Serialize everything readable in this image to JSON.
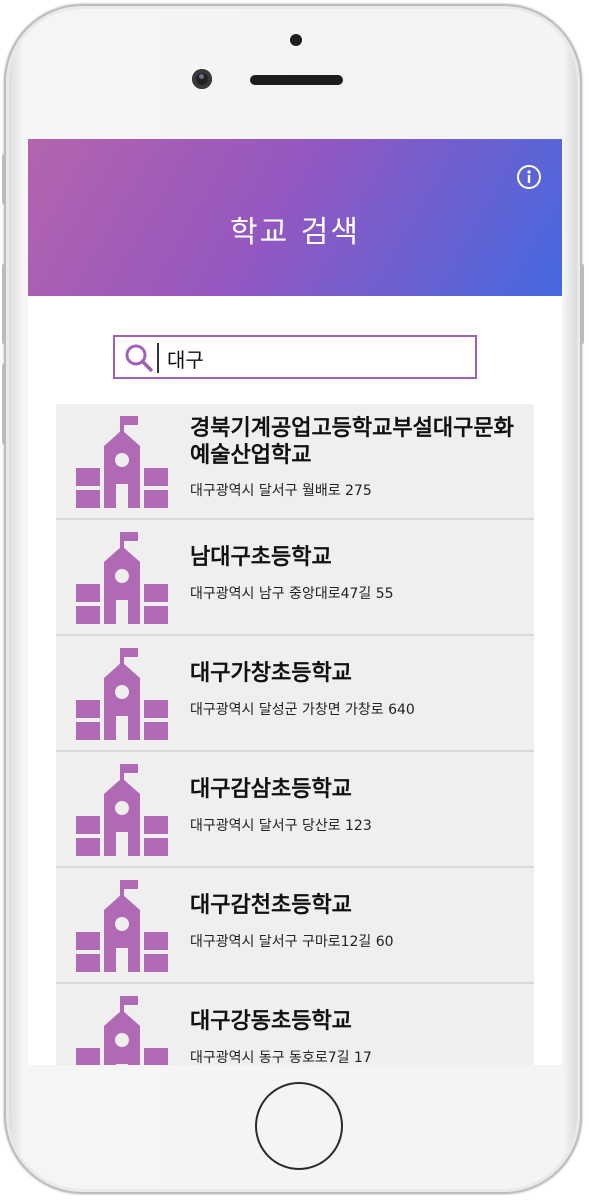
{
  "header": {
    "title": "학교 검색"
  },
  "search": {
    "value": "대구",
    "placeholder": ""
  },
  "results": [
    {
      "name": "경북기계공업고등학교부설대구문화예술산업학교",
      "address": "대구광역시 달서구 월배로 275"
    },
    {
      "name": "남대구초등학교",
      "address": "대구광역시 남구 중앙대로47길 55"
    },
    {
      "name": "대구가창초등학교",
      "address": "대구광역시 달성군 가창면 가창로 640"
    },
    {
      "name": "대구감삼초등학교",
      "address": "대구광역시 달서구 당산로 123"
    },
    {
      "name": "대구감천초등학교",
      "address": "대구광역시 달서구 구마로12길 60"
    },
    {
      "name": "대구강동초등학교",
      "address": "대구광역시 동구 동호로7길 17"
    }
  ],
  "icons": {
    "info": "info-icon",
    "search": "search-icon",
    "school": "school-icon"
  },
  "colors": {
    "header_gradient_start": "#b364ad",
    "header_gradient_end": "#4469e0",
    "accent": "#a15fb8",
    "school_icon": "#b06ab3",
    "list_background": "#efefef"
  }
}
